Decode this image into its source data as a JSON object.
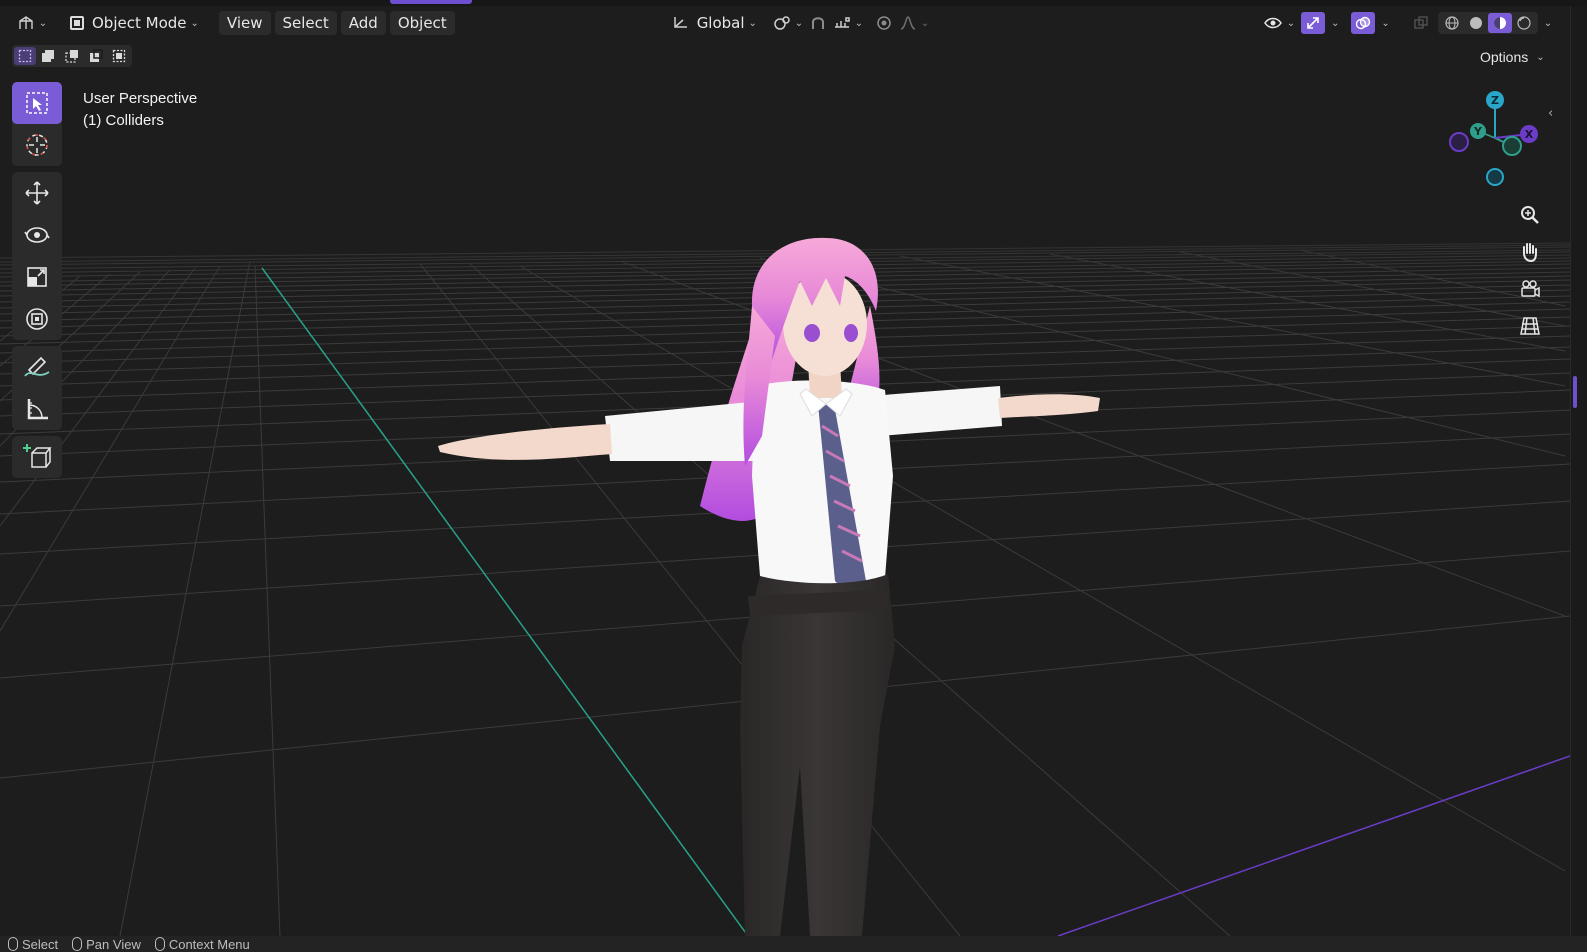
{
  "header": {
    "editor_type_icon": "3d-viewport-icon",
    "mode": "Object Mode",
    "menus": [
      "View",
      "Select",
      "Add",
      "Object"
    ],
    "transform_orientation": "Global",
    "options_label": "Options"
  },
  "viewport": {
    "perspective_label": "User Perspective",
    "collection_label": "(1) Colliders"
  },
  "gizmo": {
    "axis_z": "Z",
    "axis_y": "Y",
    "axis_x": "X",
    "colors": {
      "x": "#6a3cc8",
      "y": "#2f9e8a",
      "z": "#2aa6c8"
    }
  },
  "toolbar": {
    "tools": [
      "select-box",
      "cursor",
      "move",
      "rotate",
      "scale",
      "transform",
      "annotate",
      "measure",
      "add-cube"
    ],
    "active_tool": "select-box"
  },
  "statusbar": {
    "select": "Select",
    "pan_view": "Pan View",
    "context_menu": "Context Menu"
  },
  "colors": {
    "accent": "#7a5cd6",
    "background": "#1d1d1d",
    "x_axis_line": "#6a3cc8",
    "y_axis_line": "#29a08a"
  }
}
